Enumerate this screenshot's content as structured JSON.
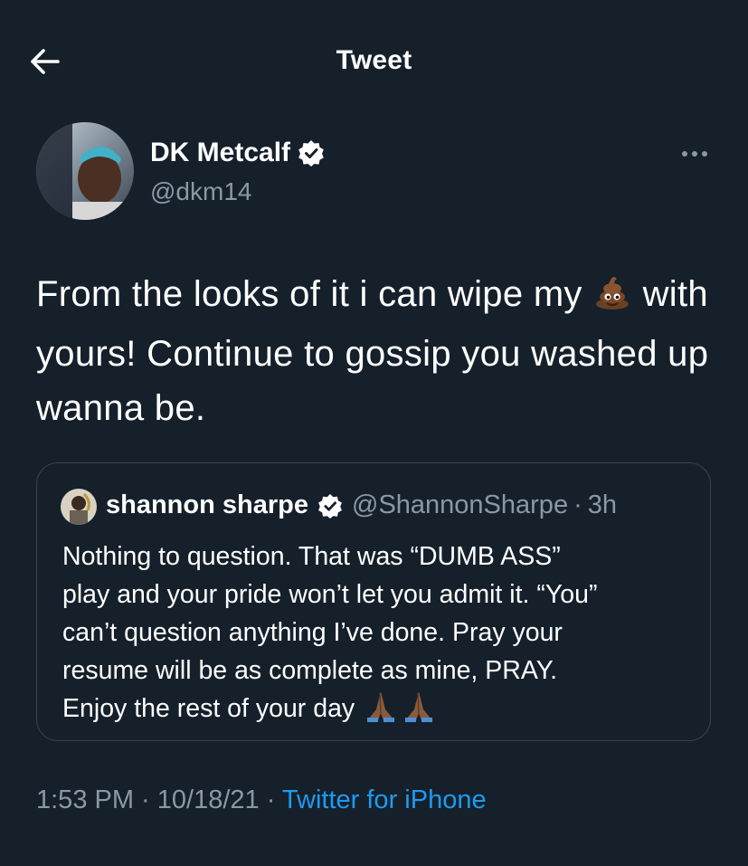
{
  "header": {
    "title": "Tweet",
    "back_icon": "arrow-left-icon"
  },
  "tweet": {
    "author": {
      "name": "DK Metcalf",
      "handle": "@dkm14",
      "verified": true
    },
    "text_before_emoji": "From the looks of it i can wipe my ",
    "emoji": "pile-of-poo-icon",
    "text_after_emoji": " with yours! Continue to gossip you washed up wanna be.",
    "quoted": {
      "name": "shannon sharpe",
      "handle": "@ShannonSharpe",
      "separator": "·",
      "time": "3h",
      "verified": true,
      "lines": [
        "Nothing to question. That was “DUMB ASS”",
        "play and your pride won’t  let you admit it. “You”",
        "can’t question anything I’ve done. Pray your",
        "resume will be as complete as mine, PRAY.",
        "Enjoy the rest of your day "
      ],
      "trailing_emoji": "folded-hands-icon"
    },
    "meta": {
      "time": "1:53 PM",
      "sep1": " · ",
      "date": "10/18/21",
      "sep2": " · ",
      "source": "Twitter for iPhone"
    }
  },
  "colors": {
    "background": "#15202b",
    "text_primary": "#ffffff",
    "text_secondary": "#8b98a5",
    "accent": "#1d9bf0",
    "border": "#38444d"
  }
}
